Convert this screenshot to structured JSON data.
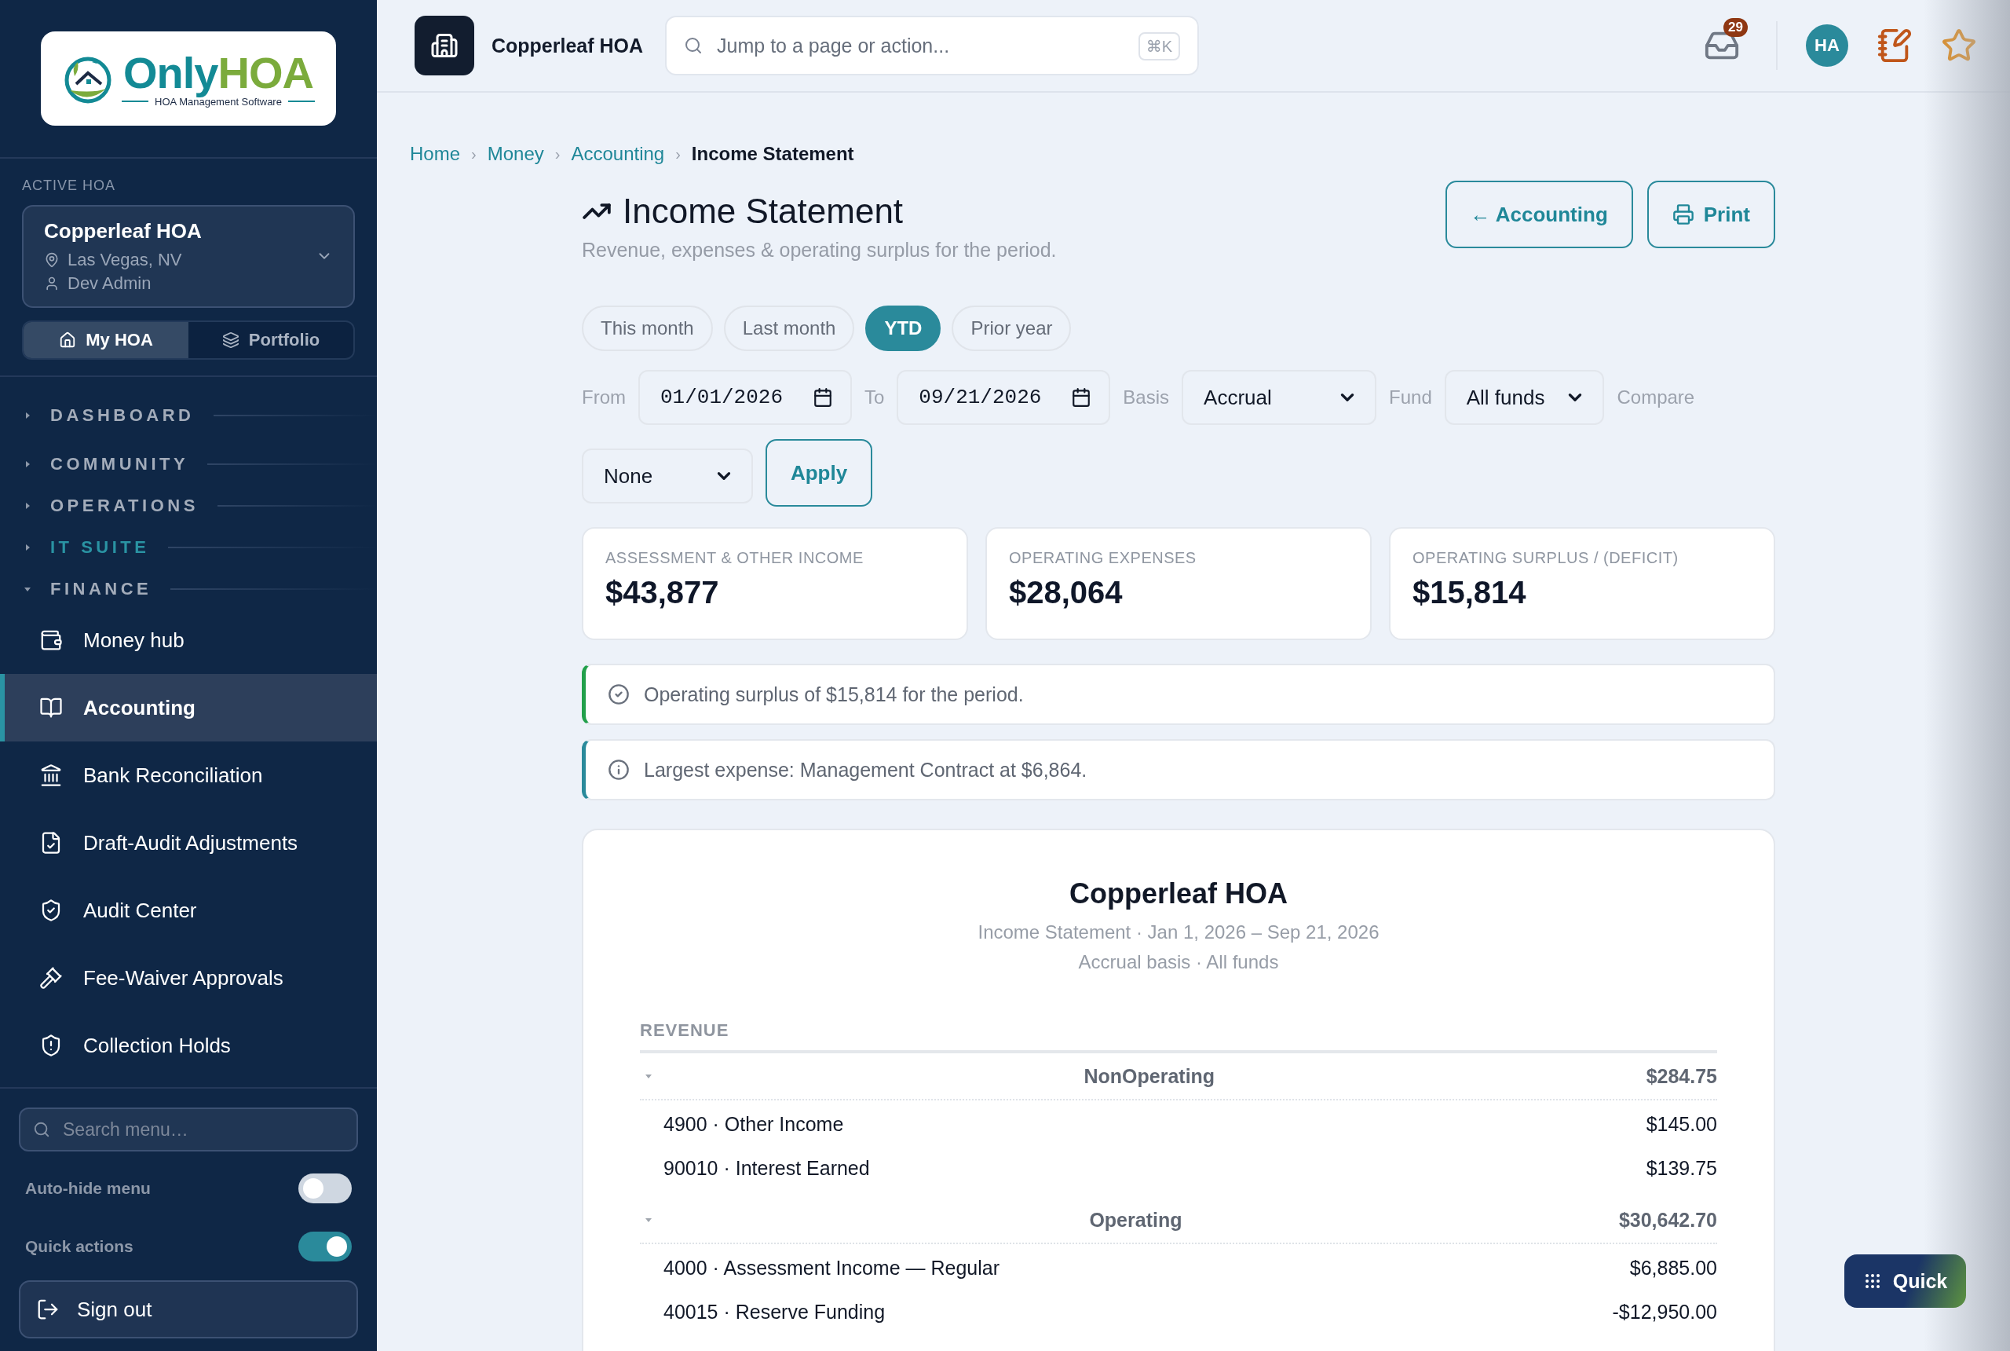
{
  "logo": {
    "word_1": "Only",
    "word_2": "HOA",
    "tagline": "HOA Management Software"
  },
  "sidebar": {
    "active_label": "ACTIVE HOA",
    "hoa": {
      "name": "Copperleaf HOA",
      "location": "Las Vegas, NV",
      "user": "Dev Admin"
    },
    "scope_tabs": [
      {
        "label": "My HOA",
        "kind": "home",
        "selected": true
      },
      {
        "label": "Portfolio",
        "kind": "layers",
        "selected": false
      }
    ],
    "sections": [
      {
        "label": "DASHBOARD",
        "expanded": false,
        "highlighted": false
      },
      {
        "label": "COMMUNITY",
        "expanded": false,
        "highlighted": false
      },
      {
        "label": "OPERATIONS",
        "expanded": false,
        "highlighted": false
      },
      {
        "label": "IT SUITE",
        "expanded": false,
        "highlighted": true
      },
      {
        "label": "FINANCE",
        "expanded": true,
        "highlighted": false
      }
    ],
    "nav_items": [
      {
        "label": "Money hub",
        "kind": "wallet",
        "selected": false
      },
      {
        "label": "Accounting",
        "kind": "book",
        "selected": true
      },
      {
        "label": "Bank Reconciliation",
        "kind": "bank",
        "selected": false
      },
      {
        "label": "Draft-Audit Adjustments",
        "kind": "file",
        "selected": false
      },
      {
        "label": "Audit Center",
        "kind": "shield-check",
        "selected": false
      },
      {
        "label": "Fee-Waiver Approvals",
        "kind": "gavel",
        "selected": false
      },
      {
        "label": "Collection Holds",
        "kind": "shield-alert",
        "selected": false
      }
    ],
    "search": {
      "placeholder": "Search menu…"
    },
    "toggles": [
      {
        "label": "Auto-hide menu",
        "on": false
      },
      {
        "label": "Quick actions",
        "on": true
      }
    ],
    "sign_out": "Sign out"
  },
  "header": {
    "brand": "Copperleaf HOA",
    "search": {
      "placeholder": "Jump to a page or action...",
      "shortcut": "⌘K"
    },
    "inbox_count": "29",
    "avatar": "HA"
  },
  "breadcrumb": [
    "Home",
    "Money",
    "Accounting",
    "Income Statement"
  ],
  "breadcrumb_separator": "›",
  "title": "Income Statement",
  "subtitle": "Revenue, expenses & operating surplus for the period.",
  "actions": [
    {
      "label": "← Accounting",
      "kind": "back"
    },
    {
      "label": "Print",
      "kind": "print"
    }
  ],
  "periods": [
    {
      "label": "This month",
      "selected": false
    },
    {
      "label": "Last month",
      "selected": false
    },
    {
      "label": "YTD",
      "selected": true
    },
    {
      "label": "Prior year",
      "selected": false
    }
  ],
  "filters": [
    {
      "label": "From",
      "kind": "date",
      "value": "01/01/2026"
    },
    {
      "label": "To",
      "kind": "date",
      "value": "09/21/2026"
    },
    {
      "label": "Basis",
      "kind": "select",
      "value": "Accrual"
    },
    {
      "label": "Fund",
      "kind": "select",
      "value": "All funds"
    },
    {
      "label": "Compare",
      "kind": "select",
      "value": "None"
    }
  ],
  "apply": "Apply",
  "kpis": [
    {
      "label": "ASSESSMENT & OTHER INCOME",
      "value": "$43,877"
    },
    {
      "label": "OPERATING EXPENSES",
      "value": "$28,064"
    },
    {
      "label": "OPERATING SURPLUS / (DEFICIT)",
      "value": "$15,814"
    }
  ],
  "alerts": [
    {
      "kind": "success",
      "text": "Operating surplus of $15,814 for the period."
    },
    {
      "kind": "info",
      "text": "Largest expense: Management Contract at $6,864."
    }
  ],
  "report": {
    "title": "Copperleaf HOA",
    "lines": [
      "Income Statement · Jan 1, 2026 – Sep 21, 2026",
      "Accrual basis · All funds"
    ],
    "sections": [
      {
        "heading": "REVENUE",
        "groups": [
          {
            "name": "NonOperating",
            "total": "$284.75",
            "expanded": true,
            "accounts": [
              {
                "name": "4900 · Other Income",
                "amount": "$145.00"
              },
              {
                "name": "90010 · Interest Earned",
                "amount": "$139.75"
              }
            ]
          },
          {
            "name": "Operating",
            "total": "$30,642.70",
            "expanded": true,
            "accounts": [
              {
                "name": "4000 · Assessment Income — Regular",
                "amount": "$6,885.00"
              },
              {
                "name": "40015 · Reserve Funding",
                "amount": "-$12,950.00"
              }
            ]
          }
        ]
      }
    ]
  },
  "quick": "Quick"
}
